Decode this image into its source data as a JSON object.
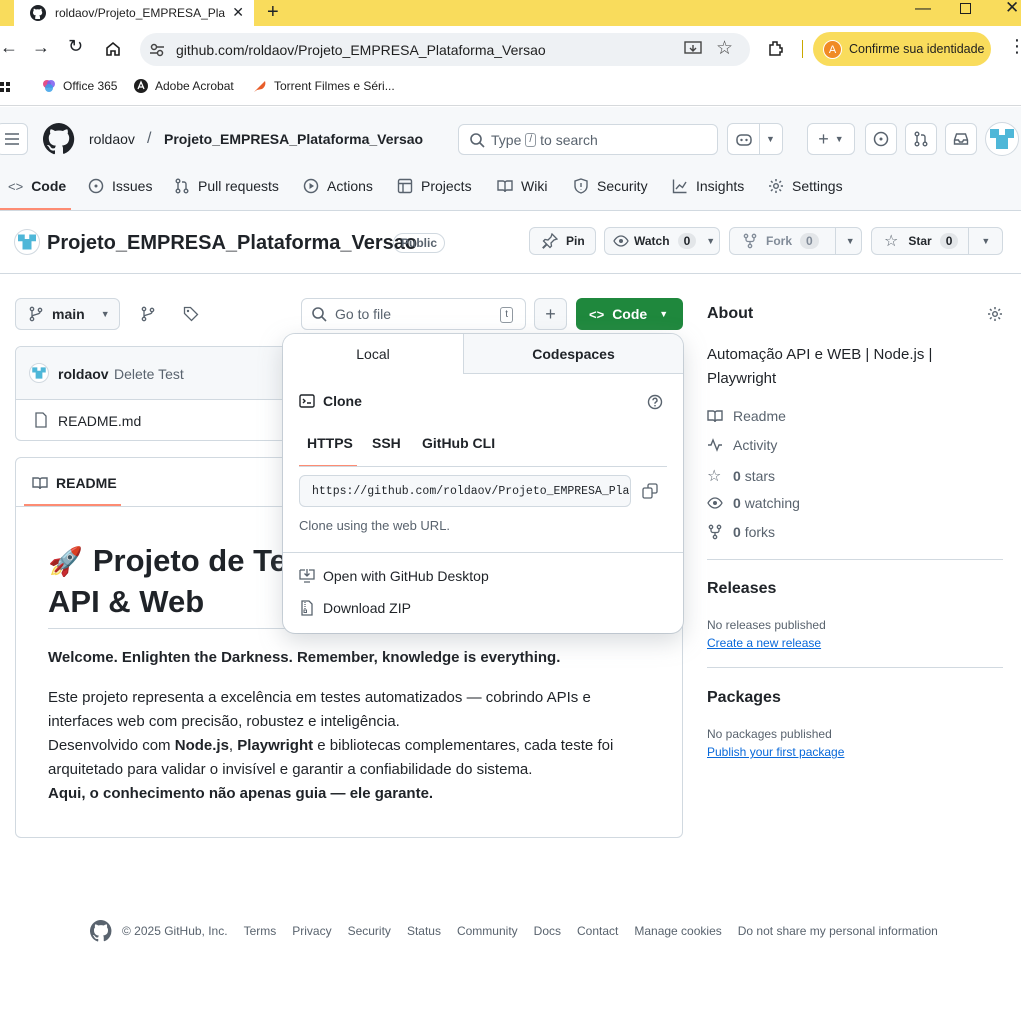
{
  "browser": {
    "tab_title": "roldaov/Projeto_EMPRESA_Plataforma_Versao",
    "url": "github.com/roldaov/Projeto_EMPRESA_Plataforma_Versao",
    "identity_button": "Confirme sua identidade",
    "bookmarks": [
      "Office 365",
      "Adobe Acrobat",
      "Torrent Filmes e Séri..."
    ]
  },
  "header": {
    "owner": "roldaov",
    "separator": "/",
    "repo": "Projeto_EMPRESA_Plataforma_Versao",
    "search_prefix": "Type",
    "search_key": "/",
    "search_suffix": "to search"
  },
  "nav": {
    "code": "Code",
    "issues": "Issues",
    "pull_requests": "Pull requests",
    "actions": "Actions",
    "projects": "Projects",
    "wiki": "Wiki",
    "security": "Security",
    "insights": "Insights",
    "settings": "Settings"
  },
  "repo_title": {
    "name": "Projeto_EMPRESA_Plataforma_Versao",
    "visibility": "Public",
    "pin": "Pin",
    "watch": "Watch",
    "watch_count": "0",
    "fork": "Fork",
    "fork_count": "0",
    "star": "Star",
    "star_count": "0"
  },
  "files": {
    "branch": "main",
    "go_to_file": "Go to file",
    "go_to_file_key": "t",
    "code_button": "Code",
    "commit_author": "roldaov",
    "commit_message": "Delete Test",
    "file_name": "README.md"
  },
  "readme": {
    "tab": "README",
    "heading_line1": "Projeto de Te",
    "heading_line2": "API & Web",
    "tagline": "Welcome. Enlighten the Darkness. Remember, knowledge is everything.",
    "p1_line1": "Este projeto representa a excelência em testes automatizados — cobrindo APIs e",
    "p1_line2": "interfaces web com precisão, robustez e inteligência.",
    "p2_a": "Desenvolvido com ",
    "p2_b": "Node.js",
    "p2_c": ", ",
    "p2_d": "Playwright",
    "p2_e": " e bibliotecas complementares, cada teste foi",
    "p2_line2": "arquitetado para validar o invisível e garantir a confiabilidade do sistema.",
    "p3": "Aqui, o conhecimento não apenas guia — ele garante."
  },
  "clone_popup": {
    "tab_local": "Local",
    "tab_codespaces": "Codespaces",
    "clone_title": "Clone",
    "subtabs": [
      "HTTPS",
      "SSH",
      "GitHub CLI"
    ],
    "url": "https://github.com/roldaov/Projeto_EMPRESA_Plataforma_Versao.git",
    "hint": "Clone using the web URL.",
    "open_desktop": "Open with GitHub Desktop",
    "download_zip": "Download ZIP"
  },
  "about": {
    "title": "About",
    "description_line1": "Automação API e WEB | Node.js |",
    "description_line2": "Playwright",
    "readme": "Readme",
    "activity": "Activity",
    "stars_count": "0",
    "stars_label": "stars",
    "watching_count": "0",
    "watching_label": "watching",
    "forks_count": "0",
    "forks_label": "forks",
    "releases_title": "Releases",
    "releases_empty": "No releases published",
    "releases_link": "Create a new release",
    "packages_title": "Packages",
    "packages_empty": "No packages published",
    "packages_link": "Publish your first package"
  },
  "footer": {
    "copyright": "© 2025 GitHub, Inc.",
    "links": [
      "Terms",
      "Privacy",
      "Security",
      "Status",
      "Community",
      "Docs",
      "Contact",
      "Manage cookies",
      "Do not share my personal information"
    ]
  },
  "colors": {
    "tab_bar": "#f9dc5c",
    "accent_green": "#1f883d",
    "link_blue": "#0969da",
    "nav_underline": "#fd8c73"
  }
}
